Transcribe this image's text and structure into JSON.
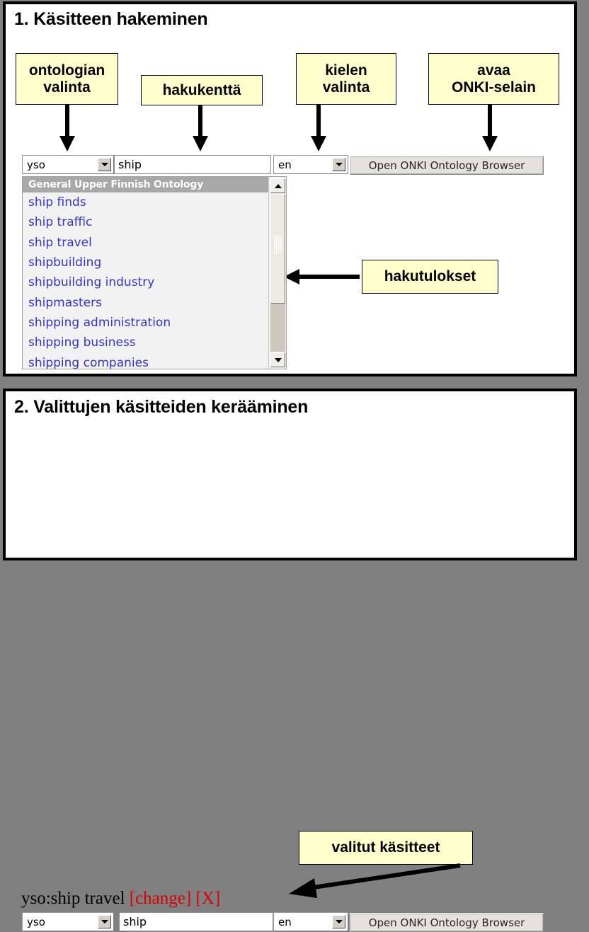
{
  "panels": [
    {
      "id": "step-1",
      "title": "1. Käsitteen hakeminen",
      "callouts": [
        {
          "name": "ontology-selector-callout",
          "label": "ontologian\nvalinta"
        },
        {
          "name": "search-field-callout",
          "label": "hakukenttä"
        },
        {
          "name": "language-selector-callout",
          "label": "kielen\nvalinta"
        },
        {
          "name": "open-browser-callout",
          "label": "avaa\nONKI-selain"
        },
        {
          "name": "search-results-callout",
          "label": "hakutulokset"
        }
      ],
      "form": {
        "ontology_value": "yso",
        "search_value": "ship",
        "search_placeholder": "",
        "language_value": "en",
        "open_browser_label": "Open ONKI Ontology Browser"
      },
      "results": {
        "group_header": "General Upper Finnish Ontology",
        "items": [
          "ship finds",
          "ship traffic",
          "ship travel",
          "shipbuilding",
          "shipbuilding industry",
          "shipmasters",
          "shipping administration",
          "shipping business",
          "shipping companies"
        ]
      }
    },
    {
      "id": "step-2",
      "title": "2. Valittujen käsitteiden kerääminen",
      "callouts": [
        {
          "name": "selected-concepts-callout",
          "label": "valitut käsitteet"
        }
      ],
      "selected_concept": {
        "concept": "yso:ship travel",
        "change_label": "[change]",
        "remove_label": "[X]"
      },
      "form": {
        "ontology_value": "yso",
        "search_value": "ship",
        "language_value": "en",
        "open_browser_label": "Open ONKI Ontology Browser"
      }
    }
  ],
  "callout_labels": {
    "ontologian_valinta_line1": "ontologian",
    "ontologian_valinta_line2": "valinta",
    "hakukenttä": "hakukenttä",
    "kielen_line1": "kielen",
    "kielen_line2": "valinta",
    "avaa_line1": "avaa",
    "avaa_line2": "ONKI-selain",
    "hakutulokset": "hakutulokset",
    "valitut_kasitteet": "valitut käsitteet"
  },
  "colors": {
    "callout_fill": "#ffffcc",
    "callout_border": "#000000",
    "result_link": "#3333cc",
    "group_header_bg": "#a8a8a8",
    "remove_link": "#dd0000",
    "page_background": "#808080"
  }
}
